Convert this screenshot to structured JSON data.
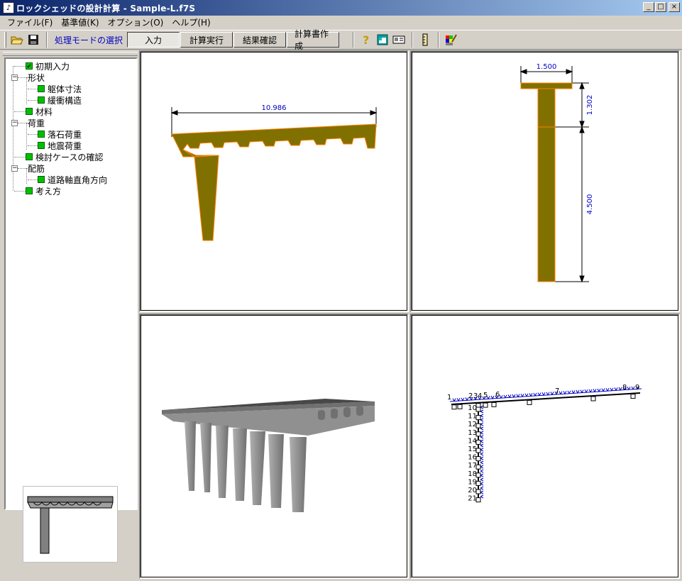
{
  "window": {
    "title": "ロックシェッドの設計計算 - Sample-L.f7S"
  },
  "menu": [
    {
      "label": "ファイル(F)"
    },
    {
      "label": "基準値(K)"
    },
    {
      "label": "オプション(O)"
    },
    {
      "label": "ヘルプ(H)"
    }
  ],
  "toolbar": {
    "mode_label": "処理モードの選択",
    "modes": [
      {
        "label": "入力",
        "active": true
      },
      {
        "label": "計算実行"
      },
      {
        "label": "結果確認"
      },
      {
        "label": "計算書作成"
      }
    ]
  },
  "tree": [
    {
      "label": "初期入力",
      "checked": true
    },
    {
      "label": "形状"
    },
    {
      "label": "躯体寸法"
    },
    {
      "label": "緩衝構造"
    },
    {
      "label": "材料"
    },
    {
      "label": "荷重"
    },
    {
      "label": "落石荷重"
    },
    {
      "label": "地震荷重"
    },
    {
      "label": "検討ケースの確認"
    },
    {
      "label": "配筋"
    },
    {
      "label": "道路軸直角方向"
    },
    {
      "label": "考え方"
    }
  ],
  "views": {
    "front": {
      "dim_label": "10.986"
    },
    "side": {
      "top_width": "1.500",
      "upper_height": "1.302",
      "lower_height": "4.500"
    },
    "frame": {
      "top_nodes": [
        "1",
        "2",
        "3",
        "4",
        "5",
        "6",
        "7",
        "8",
        "9"
      ],
      "column_nodes": [
        "10",
        "11",
        "12",
        "13",
        "14",
        "15",
        "16",
        "17",
        "18",
        "19",
        "20",
        "21"
      ]
    }
  },
  "colors": {
    "section_fill": "#807000",
    "section_edge": "#ff8000",
    "dim_text": "#0000c0",
    "load_arrows": "#0000c0"
  }
}
